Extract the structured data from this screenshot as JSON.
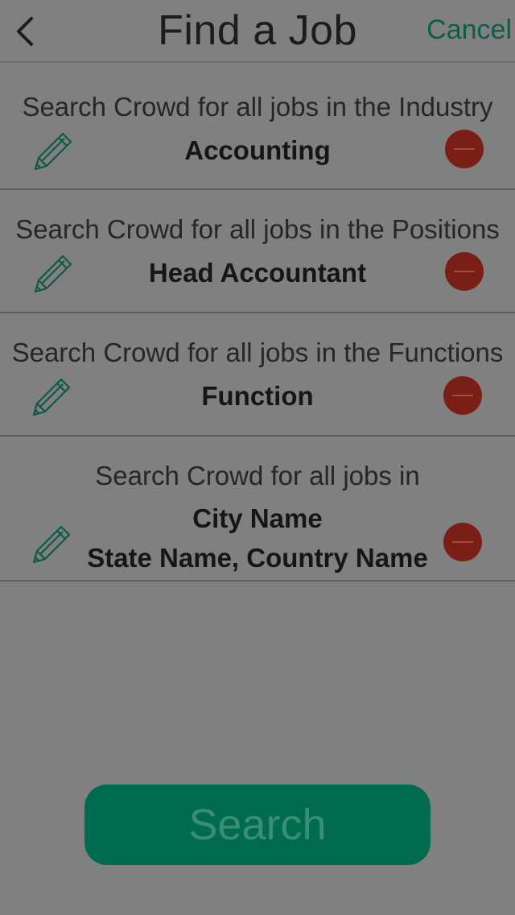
{
  "navbar": {
    "back_icon": "chevron-left-icon",
    "title": "Find a Job",
    "cancel_label": "Cancel"
  },
  "rows": [
    {
      "caption": "Search Crowd for all jobs in the Industry",
      "value": "Accounting"
    },
    {
      "caption": "Search Crowd for all jobs in the Positions",
      "value": "Head Accountant"
    },
    {
      "caption": "Search Crowd for all jobs in the Functions",
      "value": "Function"
    },
    {
      "caption": "Search Crowd for all jobs in",
      "value": "City Name",
      "value2": "State Name, Country Name"
    }
  ],
  "icons": {
    "edit": "pencil-icon",
    "remove": "minus-circle-icon"
  },
  "search_label": "Search",
  "colors": {
    "background": "#808080",
    "accent_green": "#006b4e",
    "cancel_green": "#0a5e46",
    "remove_red": "#7a1f15"
  }
}
